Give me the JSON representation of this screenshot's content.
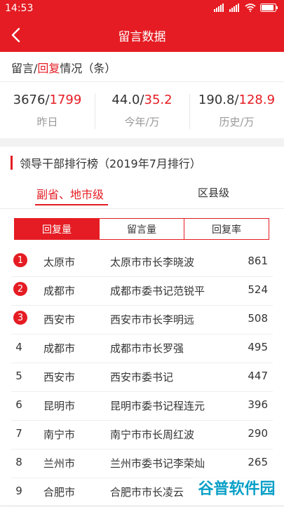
{
  "status_bar": {
    "time": "14:53",
    "battery_level_pct": 90
  },
  "app_bar": {
    "title": "留言数据"
  },
  "summary": {
    "header_prefix": "留言/",
    "header_red": "回复",
    "header_suffix": "情况（条）",
    "stats": [
      {
        "messages": "3676",
        "sep": "/",
        "replies": "1799",
        "label": "昨日"
      },
      {
        "messages": "44.0",
        "sep": "/",
        "replies": "35.2",
        "label": "今年/万"
      },
      {
        "messages": "190.8",
        "sep": "/",
        "replies": "128.9",
        "label": "历史/万"
      }
    ]
  },
  "ranking": {
    "title": "领导干部排行榜（2019年7月排行）",
    "tabs": [
      "副省、地市级",
      "区县级"
    ],
    "segments": [
      "回复量",
      "留言量",
      "回复率"
    ],
    "rows": [
      {
        "rank": "1",
        "city": "太原市",
        "person": "太原市市长李晓波",
        "count": "861"
      },
      {
        "rank": "2",
        "city": "成都市",
        "person": "成都市委书记范锐平",
        "count": "524"
      },
      {
        "rank": "3",
        "city": "西安市",
        "person": "西安市市长李明远",
        "count": "508"
      },
      {
        "rank": "4",
        "city": "成都市",
        "person": "成都市市长罗强",
        "count": "495"
      },
      {
        "rank": "5",
        "city": "西安市",
        "person": "西安市委书记",
        "count": "447"
      },
      {
        "rank": "6",
        "city": "昆明市",
        "person": "昆明市委书记程连元",
        "count": "396"
      },
      {
        "rank": "7",
        "city": "南宁市",
        "person": "南宁市市长周红波",
        "count": "290"
      },
      {
        "rank": "8",
        "city": "兰州市",
        "person": "兰州市委书记李荣灿",
        "count": "265"
      },
      {
        "rank": "9",
        "city": "合肥市",
        "person": "合肥市市长凌云",
        "count": ""
      }
    ]
  },
  "watermark": {
    "text": "谷普软件园"
  },
  "colors": {
    "accent": "#e51c23"
  }
}
